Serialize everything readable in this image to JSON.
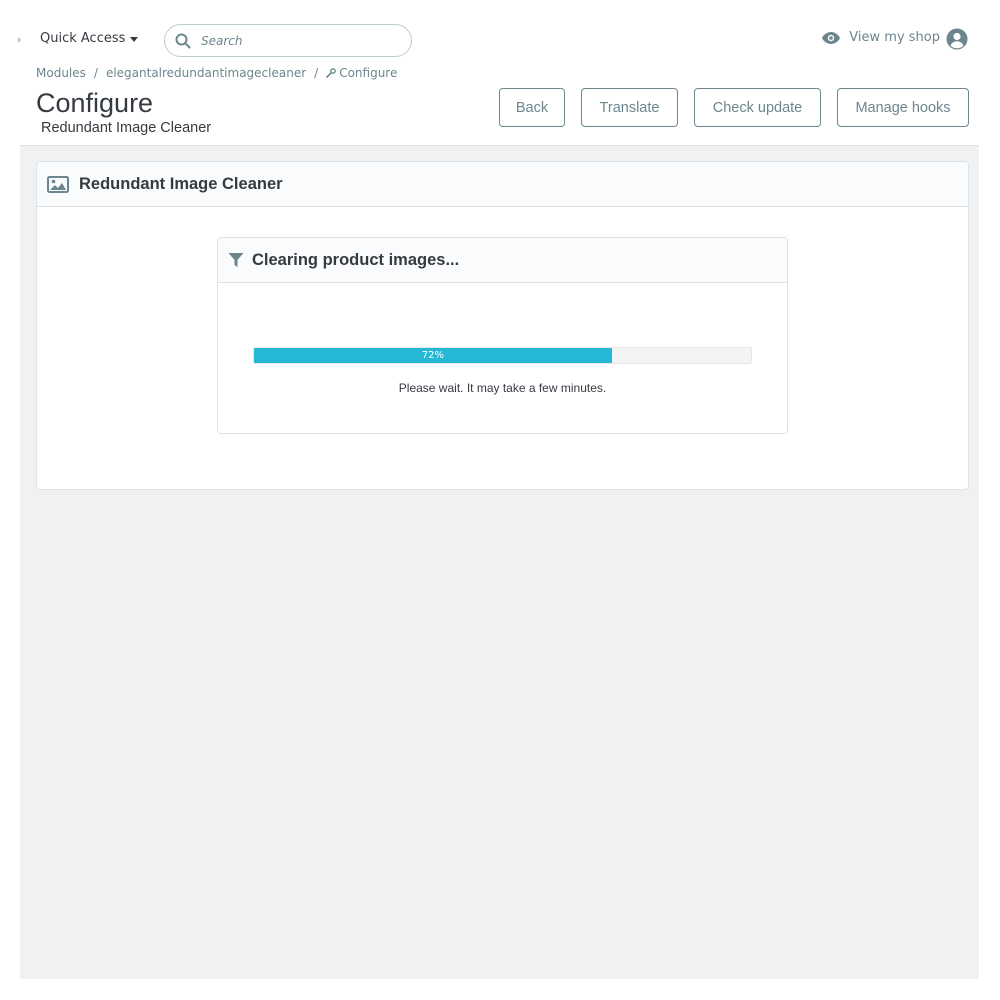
{
  "topbar": {
    "quick_access_label": "Quick Access",
    "search_placeholder": "Search",
    "view_shop_label": "View my shop"
  },
  "breadcrumb": {
    "items": [
      "Modules",
      "elegantalredundantimagecleaner",
      "Configure"
    ]
  },
  "header": {
    "title": "Configure",
    "subtitle": "Redundant Image Cleaner",
    "buttons": {
      "back": "Back",
      "translate": "Translate",
      "check_update": "Check update",
      "manage_hooks": "Manage hooks"
    }
  },
  "panel": {
    "title": "Redundant Image Cleaner",
    "icon": "image-icon"
  },
  "progress_panel": {
    "title": "Clearing product images...",
    "icon": "filter-icon",
    "progress_percent": 72,
    "progress_label": "72%",
    "wait_text": "Please wait. It may take a few minutes."
  },
  "colors": {
    "accent": "#25b9d7",
    "text": "#363a41",
    "muted": "#6c868e",
    "background": "#eff1f2"
  }
}
